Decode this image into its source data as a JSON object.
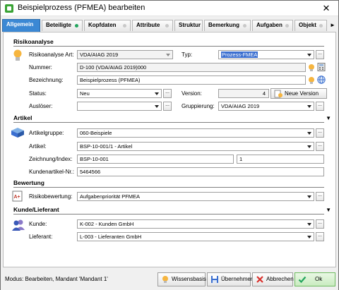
{
  "window": {
    "title": "Beispielprozess (PFMEA) bearbeiten",
    "close_glyph": "✕"
  },
  "tabs": [
    {
      "label": "Allgemein",
      "active": true
    },
    {
      "label": "Beteiligte",
      "dot": "green"
    },
    {
      "label": "Kopfdaten",
      "dot": "gray"
    },
    {
      "label": "Attribute",
      "dot": "gray"
    },
    {
      "label": "Struktur"
    },
    {
      "label": "Bemerkung",
      "dot": "gray"
    },
    {
      "label": "Aufgaben",
      "dot": "gray"
    },
    {
      "label": "Objekt",
      "dot": "gray"
    }
  ],
  "tab_more_glyph": "►",
  "risikoanalyse": {
    "header": "Risikoanalyse",
    "art_label": "Risikoanalyse Art:",
    "art_value": "VDA/AIAG 2019",
    "typ_label": "Typ:",
    "typ_value": "Prozess-FMEA",
    "nummer_label": "Nummer:",
    "nummer_value": "D-100 (VDA/AIAG 2019)000",
    "bezeichnung_label": "Bezeichnung:",
    "bezeichnung_value": "Beispielprozess (PFMEA)",
    "status_label": "Status:",
    "status_value": "Neu",
    "version_label": "Version:",
    "version_value": "4",
    "neue_version_label": "Neue Version",
    "ausloeser_label": "Auslöser:",
    "ausloeser_value": "",
    "gruppierung_label": "Gruppierung:",
    "gruppierung_value": "VDA/AIAG 2019"
  },
  "artikel": {
    "header": "Artikel",
    "gruppe_label": "Artikelgruppe:",
    "gruppe_value": "060-Beispiele",
    "artikel_label": "Artikel:",
    "artikel_value": "BSP-10-001/1 - Artikel",
    "zeichnung_label": "Zeichnung/Index:",
    "zeichnung_value": "BSP-10-001",
    "index_value": "1",
    "kundenartikel_label": "Kundenartikel-Nr.:",
    "kundenartikel_value": "5464566"
  },
  "bewertung": {
    "header": "Bewertung",
    "risiko_label": "Risikobewertung:",
    "risiko_value": "Aufgabenpriorität PFMEA"
  },
  "kunde": {
    "header": "Kunde/Lieferant",
    "kunde_label": "Kunde:",
    "kunde_value": "K-002 - Kunden GmbH",
    "lieferant_label": "Lieferant:",
    "lieferant_value": "L-003 - Lieferanten GmbH"
  },
  "status_bar": {
    "text": "Modus: Bearbeiten, Mandant 'Mandant 1'",
    "wissensbasis": "Wissensbasis",
    "uebernehmen": "Übernehmen",
    "abbrechen": "Abbrechen",
    "ok": "Ok"
  },
  "ellipsis": "...",
  "colors": {
    "accent": "#3b88d4",
    "ok_green": "#23a55d",
    "highlight": "#3b6fd0"
  }
}
